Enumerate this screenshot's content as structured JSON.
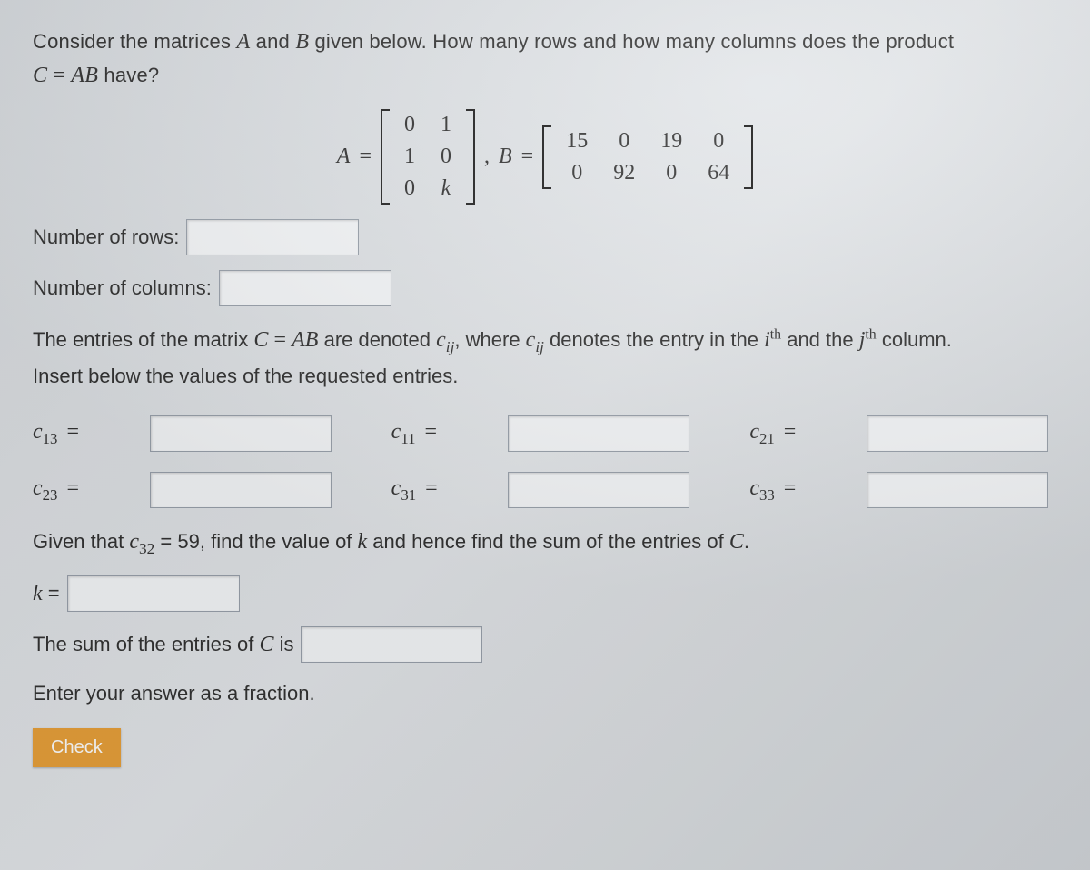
{
  "question": {
    "line1_pre": "Consider the matrices ",
    "A": "A",
    "and": " and ",
    "B": "B",
    "line1_post": " given below. How many rows and how many columns does the product",
    "line2_pre": "",
    "C": "C",
    "eq": " = ",
    "AB": "AB",
    "line2_post": " have?"
  },
  "matrices": {
    "A_label": "A",
    "eq": "=",
    "A": [
      [
        "0",
        "1"
      ],
      [
        "1",
        "0"
      ],
      [
        "0",
        "k"
      ]
    ],
    "comma": ",",
    "B_label": "B",
    "B": [
      [
        "15",
        "0",
        "19",
        "0"
      ],
      [
        "0",
        "92",
        "0",
        "64"
      ]
    ]
  },
  "rows_label": "Number of rows:",
  "cols_label": "Number of columns:",
  "para1_a": "The entries of the matrix ",
  "para1_b": " are denoted ",
  "para1_c": ", where ",
  "para1_d": " denotes the entry in the ",
  "ith": "i",
  "th": "th",
  "and_the": " and the ",
  "jth": "j",
  "para1_e": " column.",
  "para2": "Insert below the values of the requested entries.",
  "entries": {
    "c13": "c",
    "c13s": "13",
    "c11": "c",
    "c11s": "11",
    "c21": "c",
    "c21s": "21",
    "c23": "c",
    "c23s": "23",
    "c31": "c",
    "c31s": "31",
    "c33": "c",
    "c33s": "33",
    "eq": "="
  },
  "given_a": "Given that ",
  "given_c32_c": "c",
  "given_c32_s": "32",
  "given_b": " = 59, find the value of ",
  "given_k": "k",
  "given_c": " and hence find the sum of the entries of ",
  "given_C": "C",
  "given_d": ".",
  "k_label_k": "k",
  "k_label_eq": " =",
  "sum_label_a": "The sum of the entries of ",
  "sum_label_b": " is",
  "fraction_hint": "Enter your answer as a fraction.",
  "check": "Check"
}
